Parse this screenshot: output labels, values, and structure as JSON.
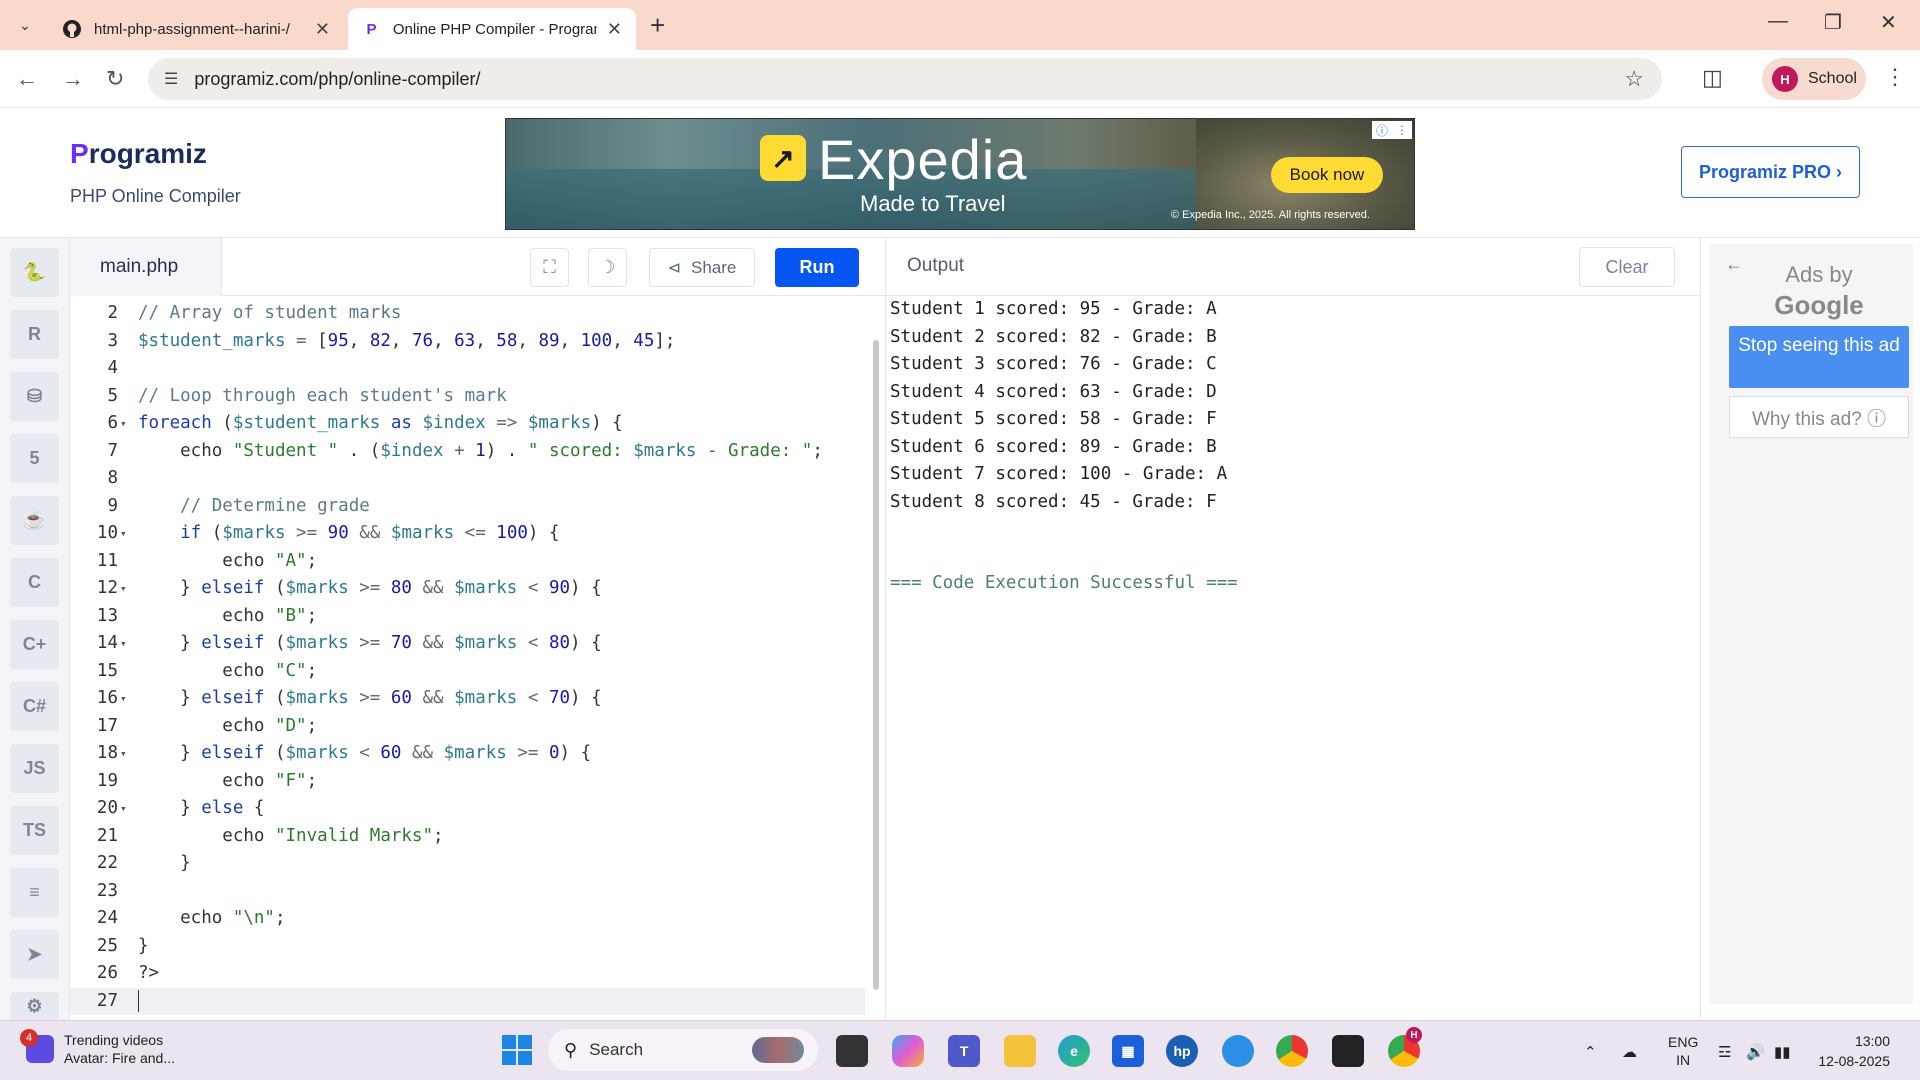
{
  "browser": {
    "tabs": [
      {
        "title": "html-php-assignment--harini-/",
        "favicon": "github-icon"
      },
      {
        "title": "Online PHP Compiler - Program",
        "favicon": "programiz-icon"
      }
    ],
    "url": "programiz.com/php/online-compiler/",
    "profile_initial": "H",
    "profile_name": "School"
  },
  "header": {
    "logo_p": "P",
    "logo_rest": "rogramiz",
    "subtitle": "PHP Online Compiler",
    "pro_button": "Programiz PRO ›"
  },
  "ad_banner": {
    "brand": "Expedia",
    "tagline": "Made to Travel",
    "cta": "Book now",
    "legal": "© Expedia Inc., 2025. All rights reserved."
  },
  "rail": {
    "items": [
      "python-icon",
      "r-icon",
      "sql-icon",
      "html-icon",
      "java-icon",
      "c-icon",
      "cpp-icon",
      "csharp-icon",
      "JS",
      "TS",
      "go-icon",
      "swift-icon",
      "rust-icon"
    ]
  },
  "editor": {
    "file_name": "main.php",
    "share_label": "Share",
    "run_label": "Run",
    "active_line": 27
  },
  "code_lines": [
    {
      "n": "2",
      "fold": false
    },
    {
      "n": "3",
      "fold": false
    },
    {
      "n": "4",
      "fold": false
    },
    {
      "n": "5",
      "fold": false
    },
    {
      "n": "6",
      "fold": true
    },
    {
      "n": "7",
      "fold": false
    },
    {
      "n": "8",
      "fold": false
    },
    {
      "n": "9",
      "fold": false
    },
    {
      "n": "10",
      "fold": true
    },
    {
      "n": "11",
      "fold": false
    },
    {
      "n": "12",
      "fold": true
    },
    {
      "n": "13",
      "fold": false
    },
    {
      "n": "14",
      "fold": true
    },
    {
      "n": "15",
      "fold": false
    },
    {
      "n": "16",
      "fold": true
    },
    {
      "n": "17",
      "fold": false
    },
    {
      "n": "18",
      "fold": true
    },
    {
      "n": "19",
      "fold": false
    },
    {
      "n": "20",
      "fold": true
    },
    {
      "n": "21",
      "fold": false
    },
    {
      "n": "22",
      "fold": false
    },
    {
      "n": "23",
      "fold": false
    },
    {
      "n": "24",
      "fold": false
    },
    {
      "n": "25",
      "fold": false
    },
    {
      "n": "26",
      "fold": false
    },
    {
      "n": "27",
      "fold": false
    }
  ],
  "code_tokens": [
    [
      [
        "cm",
        "// Array of student marks"
      ]
    ],
    [
      [
        "var",
        "$student_marks"
      ],
      [
        "op",
        " = "
      ],
      [
        "",
        "["
      ],
      [
        "num",
        "95"
      ],
      [
        "",
        ", "
      ],
      [
        "num",
        "82"
      ],
      [
        "",
        ", "
      ],
      [
        "num",
        "76"
      ],
      [
        "",
        ", "
      ],
      [
        "num",
        "63"
      ],
      [
        "",
        ", "
      ],
      [
        "num",
        "58"
      ],
      [
        "",
        ", "
      ],
      [
        "num",
        "89"
      ],
      [
        "",
        ", "
      ],
      [
        "num",
        "100"
      ],
      [
        "",
        ", "
      ],
      [
        "num",
        "45"
      ],
      [
        "",
        "];"
      ]
    ],
    [],
    [
      [
        "cm",
        "// Loop through each student's mark"
      ]
    ],
    [
      [
        "kw",
        "foreach"
      ],
      [
        "",
        " ("
      ],
      [
        "var",
        "$student_marks"
      ],
      [
        "kw",
        " as "
      ],
      [
        "var",
        "$index"
      ],
      [
        "op",
        " => "
      ],
      [
        "var",
        "$marks"
      ],
      [
        "",
        ") {"
      ]
    ],
    [
      [
        "",
        "    echo "
      ],
      [
        "str",
        "\"Student \""
      ],
      [
        "",
        " . ("
      ],
      [
        "var",
        "$index"
      ],
      [
        "op",
        " + "
      ],
      [
        "num",
        "1"
      ],
      [
        "",
        ") . "
      ],
      [
        "str",
        "\" scored: "
      ],
      [
        "var",
        "$marks"
      ],
      [
        "str",
        " - Grade: \""
      ],
      [
        "",
        ";"
      ]
    ],
    [],
    [
      [
        "cm",
        "    // Determine grade"
      ]
    ],
    [
      [
        "kw",
        "    if"
      ],
      [
        "",
        " ("
      ],
      [
        "var",
        "$marks"
      ],
      [
        "op",
        " >= "
      ],
      [
        "num",
        "90"
      ],
      [
        "op",
        " && "
      ],
      [
        "var",
        "$marks"
      ],
      [
        "op",
        " <= "
      ],
      [
        "num",
        "100"
      ],
      [
        "",
        ") {"
      ]
    ],
    [
      [
        "",
        "        echo "
      ],
      [
        "str",
        "\"A\""
      ],
      [
        "",
        ";"
      ]
    ],
    [
      [
        "",
        "    } "
      ],
      [
        "kw",
        "elseif"
      ],
      [
        "",
        " ("
      ],
      [
        "var",
        "$marks"
      ],
      [
        "op",
        " >= "
      ],
      [
        "num",
        "80"
      ],
      [
        "op",
        " && "
      ],
      [
        "var",
        "$marks"
      ],
      [
        "op",
        " < "
      ],
      [
        "num",
        "90"
      ],
      [
        "",
        ") {"
      ]
    ],
    [
      [
        "",
        "        echo "
      ],
      [
        "str",
        "\"B\""
      ],
      [
        "",
        ";"
      ]
    ],
    [
      [
        "",
        "    } "
      ],
      [
        "kw",
        "elseif"
      ],
      [
        "",
        " ("
      ],
      [
        "var",
        "$marks"
      ],
      [
        "op",
        " >= "
      ],
      [
        "num",
        "70"
      ],
      [
        "op",
        " && "
      ],
      [
        "var",
        "$marks"
      ],
      [
        "op",
        " < "
      ],
      [
        "num",
        "80"
      ],
      [
        "",
        ") {"
      ]
    ],
    [
      [
        "",
        "        echo "
      ],
      [
        "str",
        "\"C\""
      ],
      [
        "",
        ";"
      ]
    ],
    [
      [
        "",
        "    } "
      ],
      [
        "kw",
        "elseif"
      ],
      [
        "",
        " ("
      ],
      [
        "var",
        "$marks"
      ],
      [
        "op",
        " >= "
      ],
      [
        "num",
        "60"
      ],
      [
        "op",
        " && "
      ],
      [
        "var",
        "$marks"
      ],
      [
        "op",
        " < "
      ],
      [
        "num",
        "70"
      ],
      [
        "",
        ") {"
      ]
    ],
    [
      [
        "",
        "        echo "
      ],
      [
        "str",
        "\"D\""
      ],
      [
        "",
        ";"
      ]
    ],
    [
      [
        "",
        "    } "
      ],
      [
        "kw",
        "elseif"
      ],
      [
        "",
        " ("
      ],
      [
        "var",
        "$marks"
      ],
      [
        "op",
        " < "
      ],
      [
        "num",
        "60"
      ],
      [
        "op",
        " && "
      ],
      [
        "var",
        "$marks"
      ],
      [
        "op",
        " >= "
      ],
      [
        "num",
        "0"
      ],
      [
        "",
        ") {"
      ]
    ],
    [
      [
        "",
        "        echo "
      ],
      [
        "str",
        "\"F\""
      ],
      [
        "",
        ";"
      ]
    ],
    [
      [
        "",
        "    } "
      ],
      [
        "kw",
        "else"
      ],
      [
        "",
        " {"
      ]
    ],
    [
      [
        "",
        "        echo "
      ],
      [
        "str",
        "\"Invalid Marks\""
      ],
      [
        "",
        ";"
      ]
    ],
    [
      [
        "",
        "    }"
      ]
    ],
    [],
    [
      [
        "",
        "    echo "
      ],
      [
        "str",
        "\"\\n\""
      ],
      [
        "",
        ";"
      ]
    ],
    [
      [
        "",
        "}"
      ]
    ],
    [
      [
        "",
        "?>"
      ]
    ],
    []
  ],
  "output": {
    "title": "Output",
    "clear_label": "Clear",
    "lines": [
      "Student 1 scored: 95 - Grade: A",
      "Student 2 scored: 82 - Grade: B",
      "Student 3 scored: 76 - Grade: C",
      "Student 4 scored: 63 - Grade: D",
      "Student 5 scored: 58 - Grade: F",
      "Student 6 scored: 89 - Grade: B",
      "Student 7 scored: 100 - Grade: A",
      "Student 8 scored: 45 - Grade: F"
    ],
    "status": "=== Code Execution Successful ==="
  },
  "side_ad": {
    "ads_by": "Ads by",
    "google": "Google",
    "stop": "Stop seeing this ad",
    "why": "Why this ad? ⓘ"
  },
  "taskbar": {
    "widget_badge": "4",
    "widget_title": "Trending videos",
    "widget_sub": "Avatar: Fire and...",
    "search": "Search",
    "lang_1": "ENG",
    "lang_2": "IN",
    "time": "13:00",
    "date": "12-08-2025",
    "chrome_badge": "H"
  },
  "colors": {
    "run": "#0556f3",
    "brand_purple": "#6b2cf5",
    "pro_blue": "#2e6be6",
    "ad_yellow": "#fddb32"
  }
}
